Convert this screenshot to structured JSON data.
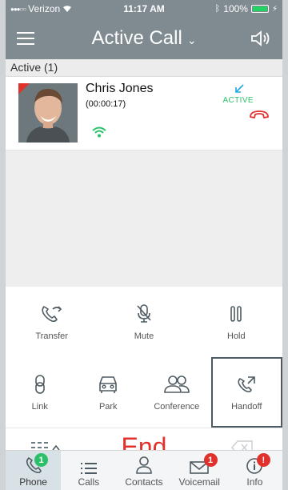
{
  "status_bar": {
    "carrier": "Verizon",
    "time": "11:17 AM",
    "battery": "100%",
    "battery_level": 1.0
  },
  "nav": {
    "title": "Active Call",
    "menu_icon": "hamburger-menu-icon",
    "speaker_icon": "speaker-icon"
  },
  "section": {
    "label": "Active (1)"
  },
  "call": {
    "name": "Chris Jones",
    "duration": "(00:00:17)",
    "status": "ACTIVE",
    "status_color": "#2bc36a",
    "arrow_color": "#23a7e5",
    "hangup_color": "#e0312d"
  },
  "controls": {
    "row1": [
      {
        "label": "Transfer",
        "icon": "transfer-icon"
      },
      {
        "label": "Mute",
        "icon": "mute-mic-icon"
      },
      {
        "label": "Hold",
        "icon": "pause-icon"
      }
    ],
    "row2": [
      {
        "label": "Link",
        "icon": "link-icon"
      },
      {
        "label": "Park",
        "icon": "car-icon"
      },
      {
        "label": "Conference",
        "icon": "conference-icon"
      },
      {
        "label": "Handoff",
        "icon": "handoff-phone-icon"
      }
    ]
  },
  "end_bar": {
    "end_label": "End",
    "end_color": "#e0312d"
  },
  "tabs": [
    {
      "label": "Phone",
      "icon": "phone-icon",
      "badge": "1",
      "badge_color": "green"
    },
    {
      "label": "Calls",
      "icon": "list-icon"
    },
    {
      "label": "Contacts",
      "icon": "contacts-icon"
    },
    {
      "label": "Voicemail",
      "icon": "voicemail-icon",
      "badge": "1",
      "badge_color": "red"
    },
    {
      "label": "Info",
      "icon": "info-icon",
      "badge": "!",
      "badge_color": "red"
    }
  ]
}
